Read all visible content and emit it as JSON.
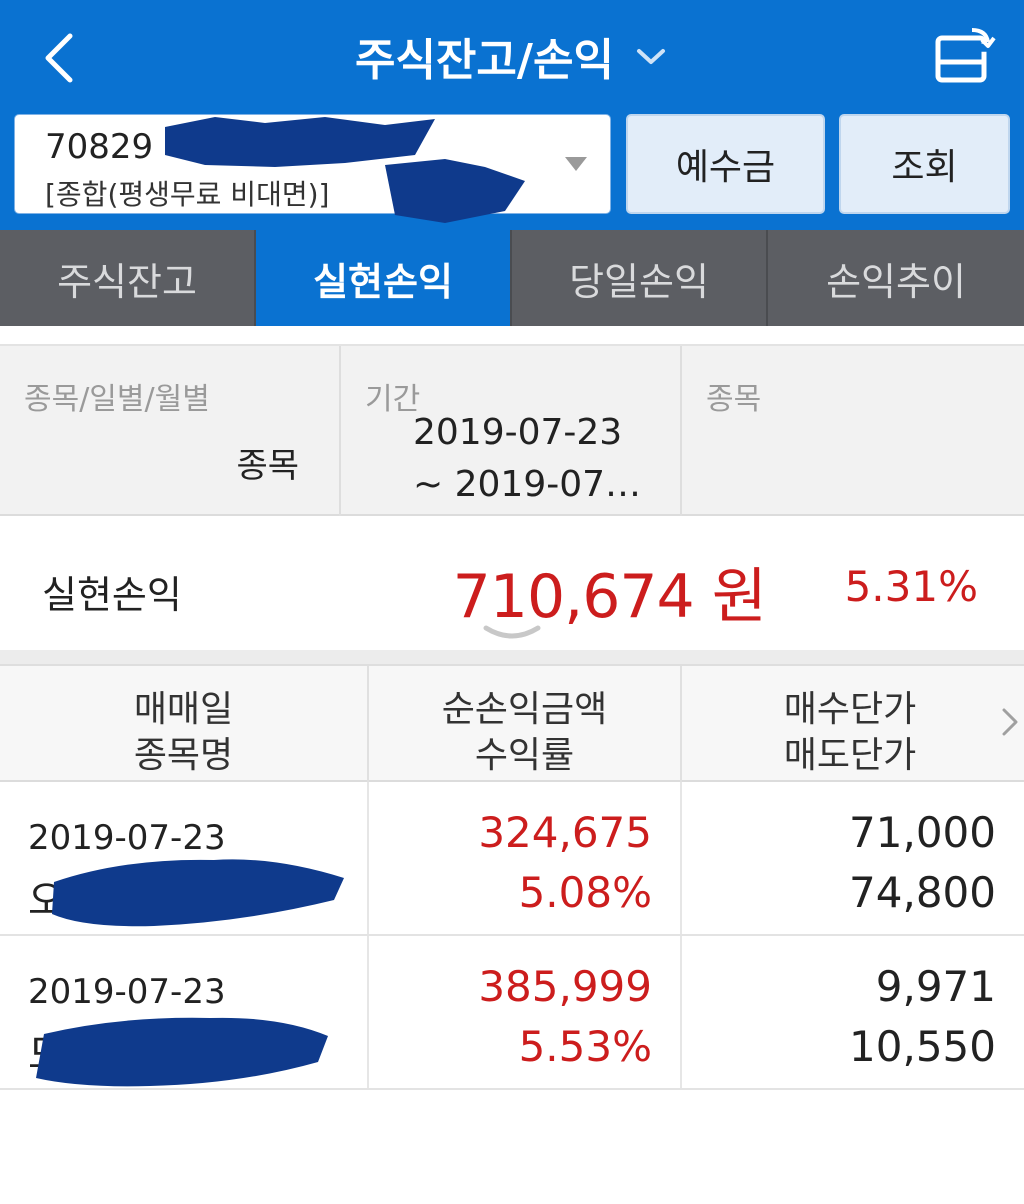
{
  "header": {
    "title": "주식잔고/손익",
    "account_number": "70829",
    "account_type": "[종합(평생무료 비대면)]",
    "deposit_button": "예수금",
    "query_button": "조회"
  },
  "tabs": [
    {
      "label": "주식잔고",
      "active": false
    },
    {
      "label": "실현손익",
      "active": true
    },
    {
      "label": "당일손익",
      "active": false
    },
    {
      "label": "손익추이",
      "active": false
    }
  ],
  "filter": {
    "mode_label": "종목/일별/월별",
    "mode_value": "종목",
    "period_label": "기간",
    "period_start": "2019-07-23",
    "period_end": "~ 2019-07…",
    "stock_label": "종목"
  },
  "summary": {
    "label": "실현손익",
    "amount": "710,674 원",
    "rate": "5.31%"
  },
  "table": {
    "headers": [
      {
        "line1": "매매일",
        "line2": "종목명"
      },
      {
        "line1": "순손익금액",
        "line2": "수익률"
      },
      {
        "line1": "매수단가",
        "line2": "매도단가"
      }
    ],
    "rows": [
      {
        "date": "2019-07-23",
        "name": "오",
        "profit": "324,675",
        "rate": "5.08%",
        "buy_price": "71,000",
        "sell_price": "74,800"
      },
      {
        "date": "2019-07-23",
        "name": "도",
        "profit": "385,999",
        "rate": "5.53%",
        "buy_price": "9,971",
        "sell_price": "10,550"
      }
    ]
  },
  "colors": {
    "primary_blue": "#0a72d1",
    "tab_gray": "#5c5e63",
    "profit_red": "#cc1d1d",
    "redaction_blue": "#0f3a8c"
  },
  "icons": {
    "back": "chevron-left-icon",
    "title_dropdown": "chevron-down-icon",
    "share": "rotate-screen-icon",
    "account_dropdown": "triangle-down-icon",
    "expand": "chevron-down-icon",
    "scroll_right": "chevron-right-icon"
  }
}
